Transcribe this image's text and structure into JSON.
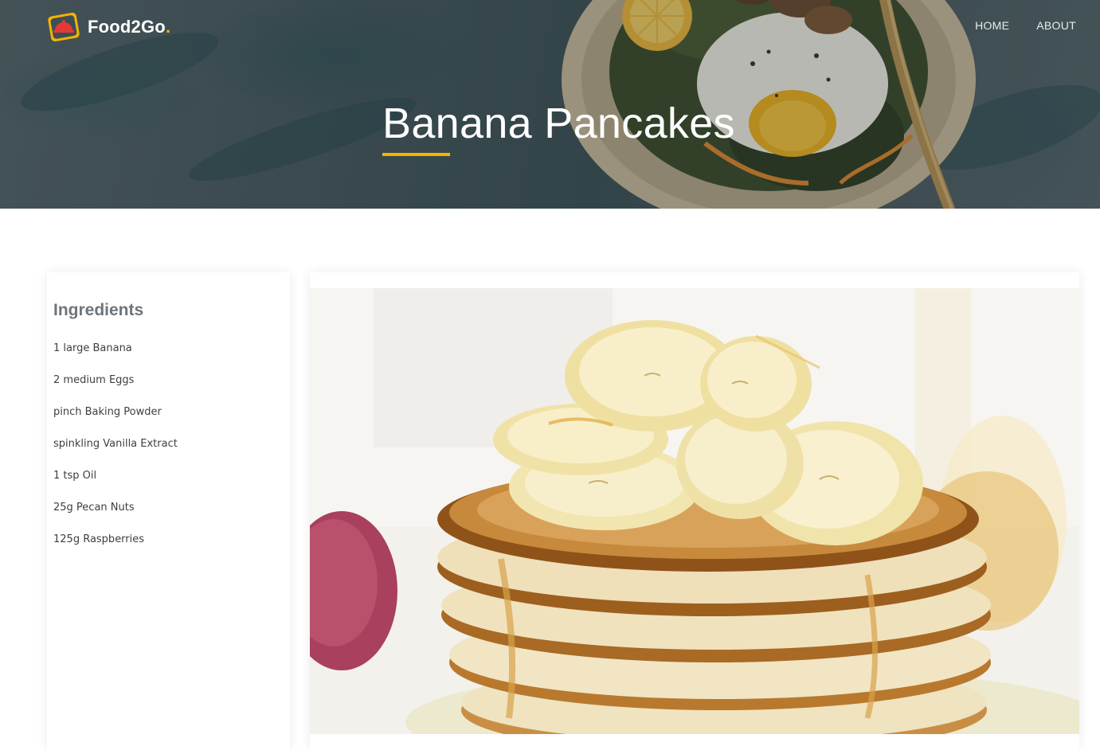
{
  "brand": {
    "name": "Food2Go",
    "dot": ".",
    "icon": "food-cloche-icon"
  },
  "nav": {
    "home": "HOME",
    "about": "ABOUT"
  },
  "hero": {
    "title": "Banana Pancakes"
  },
  "ingredients": {
    "heading": "Ingredients",
    "items": [
      "1 large Banana",
      "2 medium Eggs",
      "pinch Baking Powder",
      "spinkling Vanilla Extract",
      "1 tsp Oil",
      "25g Pecan Nuts",
      "125g Raspberries"
    ]
  },
  "colors": {
    "accent": "#f5b300",
    "logo_red": "#e53935",
    "heading_gray": "#6c757d"
  }
}
